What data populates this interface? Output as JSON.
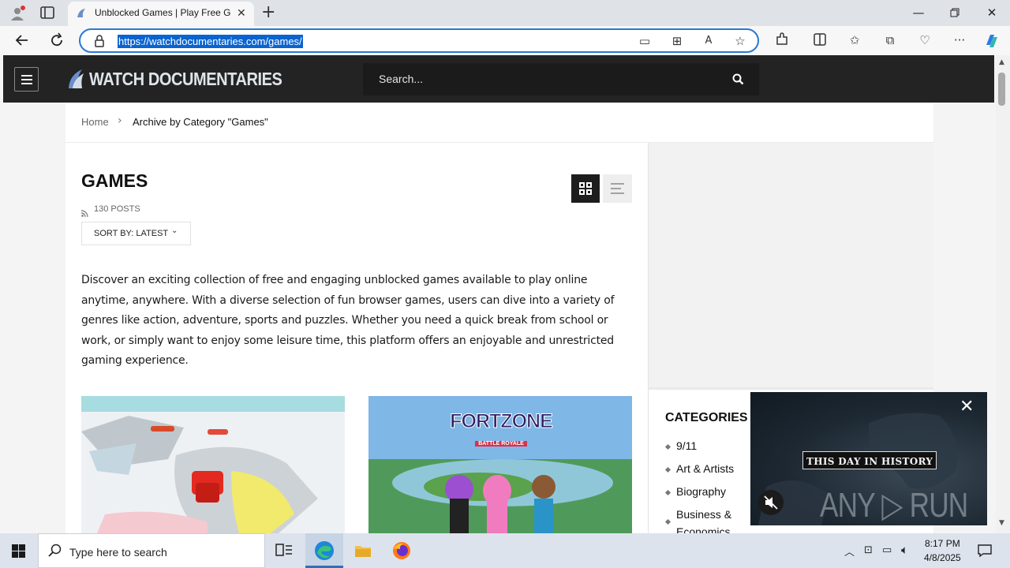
{
  "browser": {
    "tab_title": "Unblocked Games | Play Free Games",
    "url": "https://watchdocumentaries.com/games/",
    "window_controls": [
      "minimize",
      "restore",
      "close"
    ]
  },
  "site": {
    "logo": "WATCH DOCUMENTARIES",
    "search_placeholder": "Search..."
  },
  "breadcrumb": {
    "home": "Home",
    "separator": "›",
    "current": "Archive by Category \"Games\""
  },
  "category": {
    "title": "GAMES",
    "posts": "130 POSTS",
    "sort_label": "SORT BY: LATEST",
    "description": "Discover an exciting collection of free and engaging unblocked games available to play online anytime, anywhere. With a diverse selection of fun browser games, users can dive into a variety of genres like action, adventure, sports and puzzles. Whether you need a quick break from school or work, or simply want to enjoy some leisure time, this platform offers an enjoyable and unrestricted gaming experience."
  },
  "cards": [
    {
      "image": "car racing on hex tiles"
    },
    {
      "image": "Fortzone battle royale",
      "logo_text": "FORTZONE",
      "logo_sub": "BATTLE ROYALE"
    }
  ],
  "sidebar": {
    "categories_title": "CATEGORIES",
    "categories": [
      "9/11",
      "Art & Artists",
      "Biography",
      "Business &",
      "Economics"
    ]
  },
  "video_ad": {
    "banner": "THIS DAY IN HISTORY",
    "watermark": "ANY ▷ RUN"
  },
  "taskbar": {
    "search_placeholder": "Type here to search",
    "time": "8:17 PM",
    "date": "4/8/2025"
  },
  "colors": {
    "accent": "#2a78d4",
    "header_bg": "#232323",
    "url_highlight": "#0a64d0"
  }
}
